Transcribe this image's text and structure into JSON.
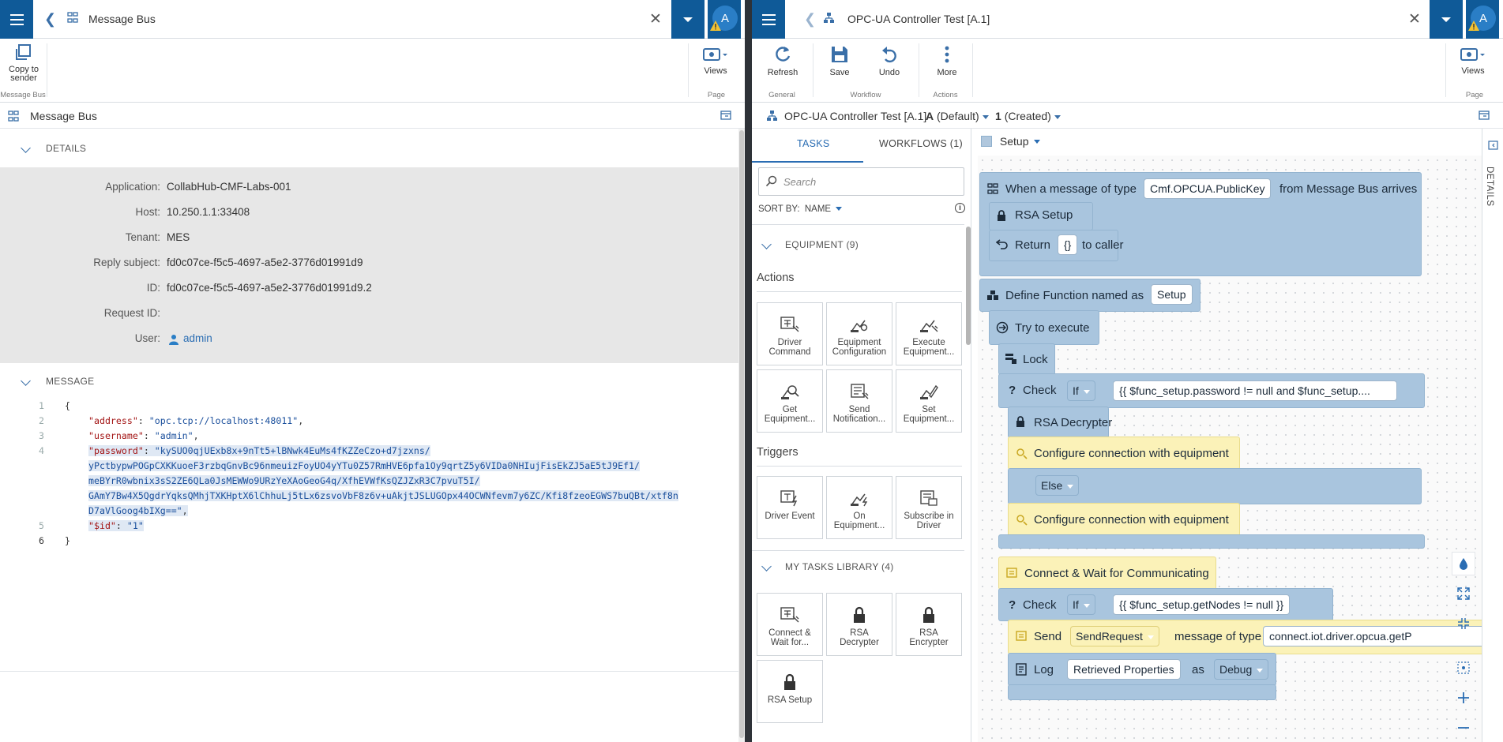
{
  "left": {
    "header": {
      "title": "Message Bus",
      "avatar": "A"
    },
    "ribbon": {
      "copy_label_1": "Copy to",
      "copy_label_2": "sender",
      "group_message_bus": "Message Bus",
      "views_label": "Views",
      "group_page": "Page"
    },
    "subheader": {
      "title": "Message Bus"
    },
    "details": {
      "section": "DETAILS",
      "rows": [
        {
          "key": "Application:",
          "value": "CollabHub-CMF-Labs-001"
        },
        {
          "key": "Host:",
          "value": "10.250.1.1:33408"
        },
        {
          "key": "Tenant:",
          "value": "MES"
        },
        {
          "key": "Reply subject:",
          "value": "fd0c07ce-f5c5-4697-a5e2-3776d01991d9"
        },
        {
          "key": "ID:",
          "value": "fd0c07ce-f5c5-4697-a5e2-3776d01991d9.2"
        },
        {
          "key": "Request ID:",
          "value": ""
        },
        {
          "key": "User:",
          "value": "admin"
        }
      ]
    },
    "message": {
      "section": "MESSAGE",
      "lines": [
        {
          "num": "1",
          "open": "{"
        },
        {
          "num": "2",
          "key": "\"address\"",
          "colon": ": ",
          "val": "\"opc.tcp://localhost:48011\"",
          "tail": ","
        },
        {
          "num": "3",
          "key": "\"username\"",
          "colon": ": ",
          "val": "\"admin\"",
          "tail": ","
        },
        {
          "num": "4",
          "key": "\"password\"",
          "colon": ": ",
          "val": "\"kySUO0qjUExb8x+9nTt5+lBNwk4EuMs4fKZZeCzo+d7jzxns/",
          "tail": ""
        },
        {
          "num": "",
          "val": "yPctbypwPOGpCXKKuoeF3rzbqGnvBc96nmeuizFoyUO4yYTu0Z57RmHVE6pfa1Oy9qrtZ5y6VIDa0NHIujFisEkZJ5aE5tJ9Ef1/",
          "tail": ""
        },
        {
          "num": "",
          "val": "meBYrR0wbnix3sS2ZE6QLa0JsMEWWo9URzYeXAoGeoG4q/XfhEVWfKsQZJZxR3C7pvuT5I/",
          "tail": ""
        },
        {
          "num": "",
          "val": "GAmY7Bw4X5QgdrYqksQMhjTXKHptX6lChhuLj5tLx6zsvoVbF8z6v+uAkjtJSLUGOpx44OCWNfevm7y6ZC/Kfi8fzeoEGWS7buQBt/xtf8n",
          "tail": ""
        },
        {
          "num": "",
          "val": "D7aVlGoog4bIXg==\"",
          "tail": ","
        },
        {
          "num": "5",
          "key": "\"$id\"",
          "colon": ": ",
          "val": "\"1\"",
          "tail": ""
        },
        {
          "num": "6",
          "open": "}"
        }
      ]
    }
  },
  "right": {
    "header": {
      "title": "OPC-UA Controller Test [A.1]",
      "avatar": "A"
    },
    "ribbon": {
      "refresh": "Refresh",
      "save": "Save",
      "undo": "Undo",
      "more": "More",
      "group_general": "General",
      "group_workflow": "Workflow",
      "group_actions": "Actions",
      "views": "Views",
      "group_page": "Page"
    },
    "subheader": {
      "title": "OPC-UA Controller Test [A.1]",
      "version": "A",
      "version_state": "(Default)",
      "revision": "1",
      "revision_state": "(Created)"
    },
    "tabs": {
      "tasks": "TASKS",
      "workflows": "WORKFLOWS (1)"
    },
    "search_placeholder": "Search",
    "sort": {
      "label": "SORT BY:",
      "value": "NAME"
    },
    "equipment": {
      "section": "EQUIPMENT (9)",
      "actions_label": "Actions",
      "triggers_label": "Triggers"
    },
    "tasks_library": {
      "section": "MY TASKS LIBRARY (4)"
    },
    "action_tiles": [
      {
        "l1": "Driver",
        "l2": "Command"
      },
      {
        "l1": "Equipment",
        "l2": "Configuration"
      },
      {
        "l1": "Execute",
        "l2": "Equipment..."
      },
      {
        "l1": "Get",
        "l2": "Equipment..."
      },
      {
        "l1": "Send",
        "l2": "Notification..."
      },
      {
        "l1": "Set",
        "l2": "Equipment..."
      }
    ],
    "trigger_tiles": [
      {
        "l1": "Driver Event",
        "l2": ""
      },
      {
        "l1": "On",
        "l2": "Equipment..."
      },
      {
        "l1": "Subscribe in",
        "l2": "Driver"
      }
    ],
    "library_tiles": [
      {
        "l1": "Connect &",
        "l2": "Wait for..."
      },
      {
        "l1": "RSA",
        "l2": "Decrypter"
      },
      {
        "l1": "RSA",
        "l2": "Encrypter"
      },
      {
        "l1": "RSA Setup",
        "l2": ""
      }
    ],
    "canvas": {
      "page_name": "Setup",
      "details_vertical": "DETAILS",
      "when": {
        "text": "When a message of type",
        "type": "Cmf.OPCUA.PublicKey",
        "tail": "from Message Bus arrives"
      },
      "rsa_setup": "RSA Setup",
      "return": {
        "text": "Return",
        "value": "{}",
        "tail": "to caller"
      },
      "define": {
        "text": "Define Function named as",
        "name": "Setup"
      },
      "try": "Try to execute",
      "lock": "Lock",
      "check1": {
        "text": "Check",
        "op": "If",
        "expr": "{{ $func_setup.password != null and $func_setup...."
      },
      "rsa_decrypter": "RSA Decrypter",
      "configure1": "Configure connection with equipment",
      "else": "Else",
      "configure2": "Configure connection with equipment",
      "connect": "Connect & Wait for Communicating",
      "check2": {
        "text": "Check",
        "op": "If",
        "expr": "{{ $func_setup.getNodes != null }}"
      },
      "send": {
        "text": "Send",
        "op": "SendRequest",
        "mid": "message of type",
        "type": "connect.iot.driver.opcua.getP"
      },
      "log": {
        "text": "Log",
        "value": "Retrieved Properties",
        "mid": "as",
        "level": "Debug"
      }
    }
  }
}
